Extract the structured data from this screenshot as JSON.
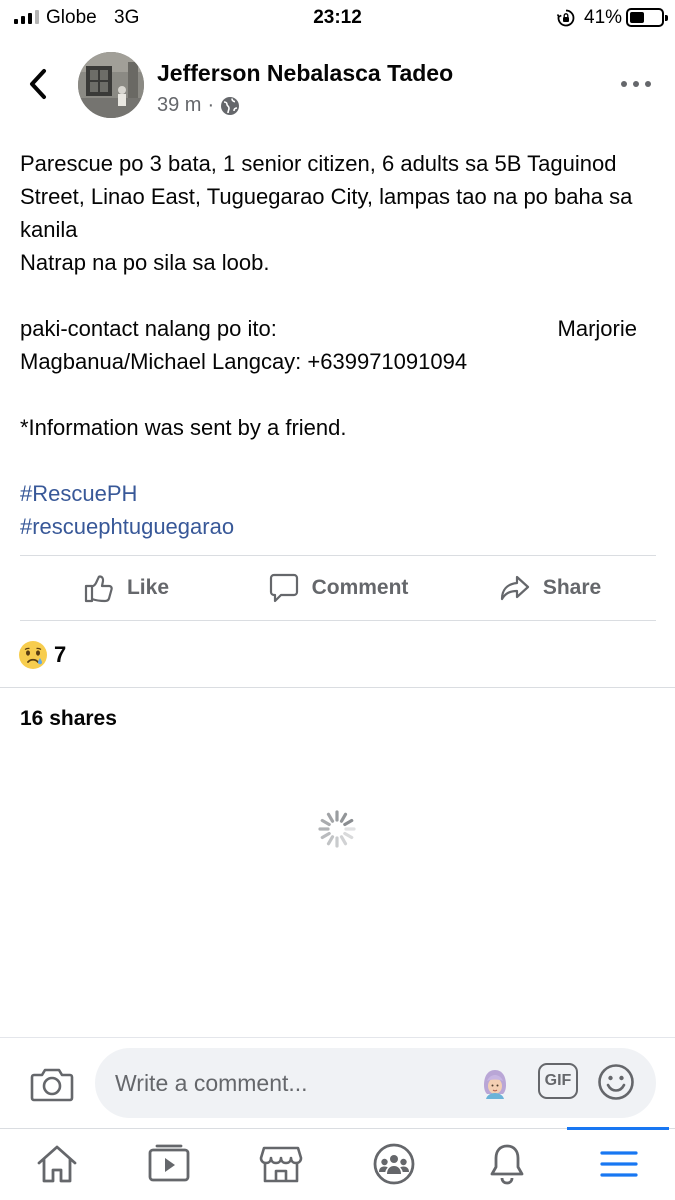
{
  "status_bar": {
    "carrier": "Globe",
    "network": "3G",
    "time": "23:12",
    "battery_percent": "41%",
    "battery_level": 0.41
  },
  "post": {
    "author": "Jefferson Nebalasca Tadeo",
    "time_ago": "39 m",
    "separator": "·",
    "privacy_icon": "globe-icon",
    "text_lines": {
      "line1": "Parescue po 3 bata, 1 senior citizen, 6 adults sa 5B Taguinod Street, Linao East, Tuguegarao City, lampas tao na po baha sa kanila",
      "line2": "Natrap na po sila sa loob.",
      "contact_label": "paki-contact nalang po ito:",
      "contact_name_start": "Marjorie",
      "contact_rest": "Magbanua/Michael Langcay: +639971091094",
      "note": "*Information was sent by a friend."
    },
    "hashtags": [
      "#RescuePH",
      "#rescuephtuguegarao"
    ]
  },
  "actions": {
    "like": "Like",
    "comment": "Comment",
    "share": "Share"
  },
  "reactions": {
    "icon": "sad-emoji-icon",
    "count": "7"
  },
  "shares_text": "16 shares",
  "comment_bar": {
    "placeholder": "Write a comment...",
    "gif_label": "GIF"
  },
  "tabbar": {
    "items": [
      "home-icon",
      "video-icon",
      "marketplace-icon",
      "groups-icon",
      "notifications-icon",
      "menu-icon"
    ],
    "active": "menu-icon"
  },
  "colors": {
    "link": "#385898",
    "secondary_text": "#65676b",
    "accent": "#1877f2",
    "divider": "#dadde1",
    "input_bg": "#f0f2f5"
  }
}
